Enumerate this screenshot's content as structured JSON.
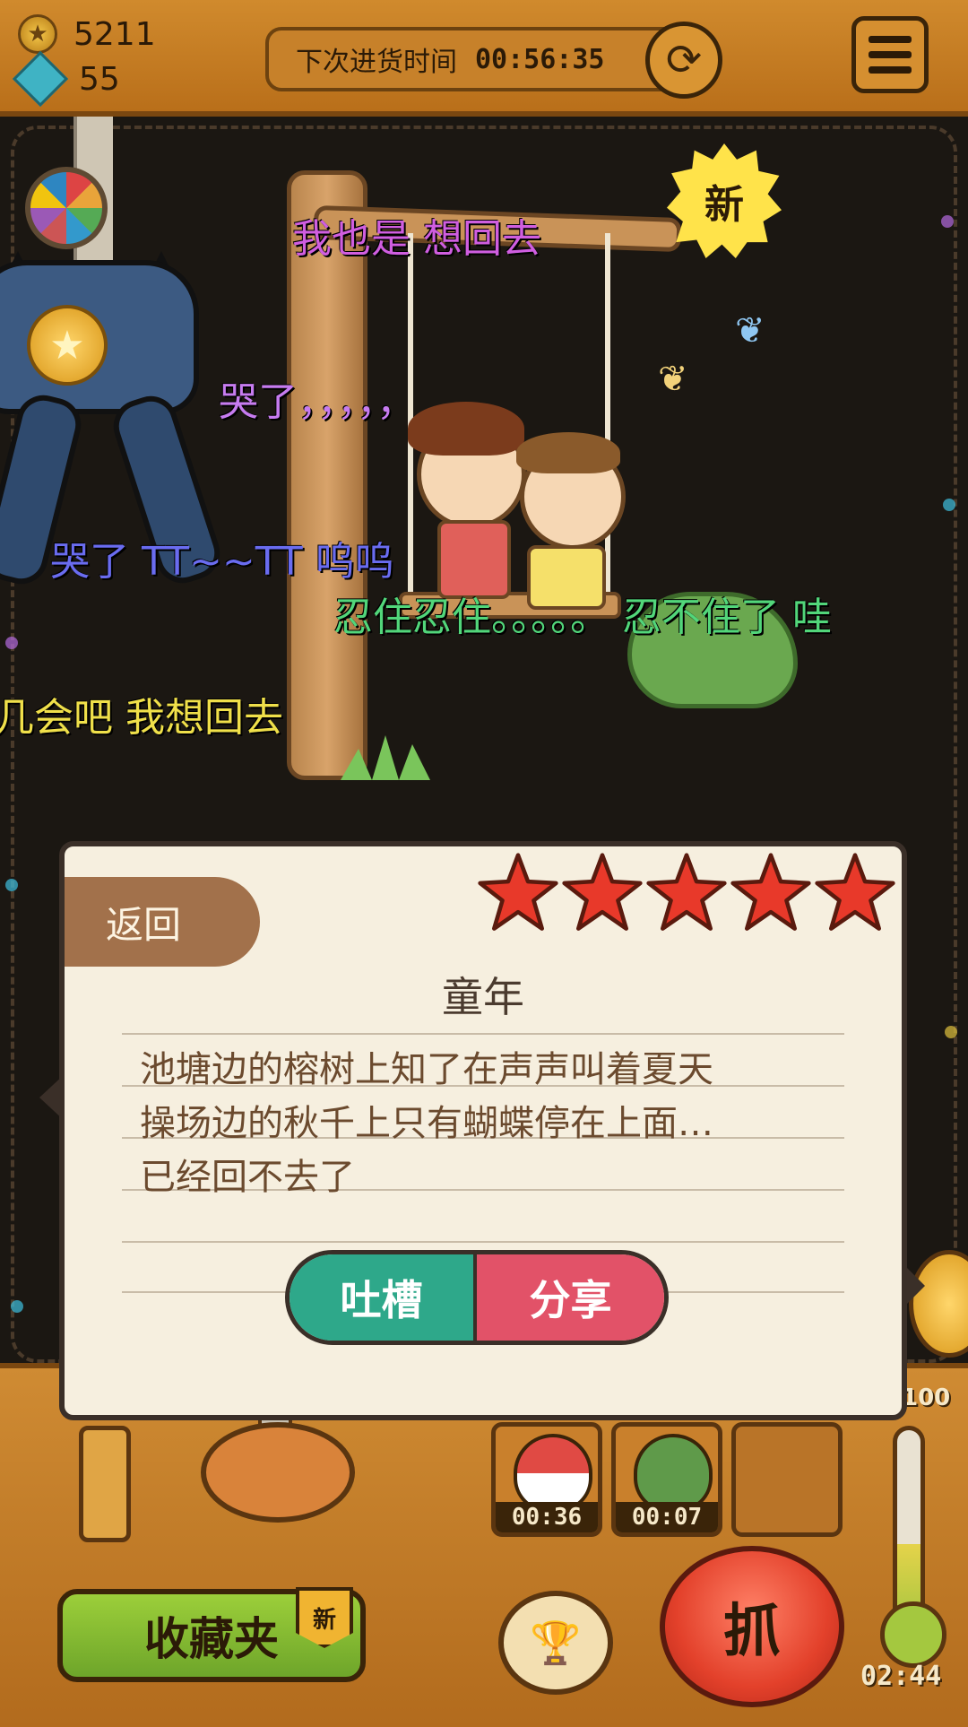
{
  "header": {
    "coins": "5211",
    "gems": "55",
    "restock_label": "下次进货时间",
    "restock_time": "00:56:35"
  },
  "scene": {
    "new_badge": "新",
    "danmaku": [
      {
        "text": "我也是 想回去",
        "color": "#d05ee0"
      },
      {
        "text": "哭了，，，，，",
        "color": "#c77cf0"
      },
      {
        "text": "哭了 TT~~TT 呜呜",
        "color": "#6a6cf0"
      },
      {
        "text": "忍住忍住。。。。。 忍不住了  哇",
        "color": "#52d67a"
      },
      {
        "text": "几会吧 我想回去",
        "color": "#f0e04a"
      }
    ]
  },
  "card": {
    "back_label": "返回",
    "rating": 5,
    "title": "童年",
    "lines": [
      "池塘边的榕树上知了在声声叫着夏天",
      "操场边的秋千上只有蝴蝶停在上面…",
      "已经回不去了"
    ],
    "roast_label": "吐槽",
    "share_label": "分享"
  },
  "bottom": {
    "egg_timers": [
      "00:36",
      "00:07"
    ],
    "collection_label": "收藏夹",
    "collection_new": "新",
    "grab_label": "抓",
    "meter_max": "100",
    "meter_level": 0.45,
    "clock": "02:44"
  },
  "colors": {
    "accent": "#b96f1a",
    "roast": "#2ea88a",
    "share": "#e25268",
    "star": "#e8392a"
  }
}
